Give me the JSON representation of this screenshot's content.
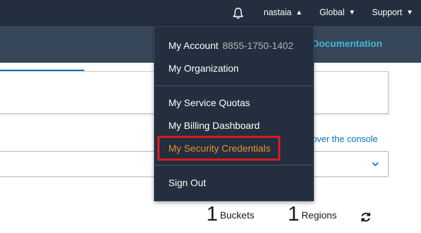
{
  "topbar": {
    "bell_icon": "bell-icon",
    "user": "nastaia",
    "region": "Global",
    "support": "Support",
    "caret_up": "▲",
    "caret_down": "▼"
  },
  "subbar": {
    "documentation": "Documentation"
  },
  "main": {
    "console_link": "over the console",
    "stats": [
      {
        "value": "1",
        "label": "Buckets"
      },
      {
        "value": "1",
        "label": "Regions"
      }
    ]
  },
  "menu": {
    "account_label": "My Account",
    "account_id": "8855-1750-1402",
    "organization": "My Organization",
    "service_quotas": "My Service Quotas",
    "billing_dashboard": "My Billing Dashboard",
    "security_credentials": "My Security Credentials",
    "sign_out": "Sign Out"
  },
  "colors": {
    "nav_bg": "#232f3e",
    "subbar_bg": "#37475a",
    "highlight_text": "#ec912d",
    "highlight_border": "#e0191f",
    "link": "#0073bb"
  }
}
